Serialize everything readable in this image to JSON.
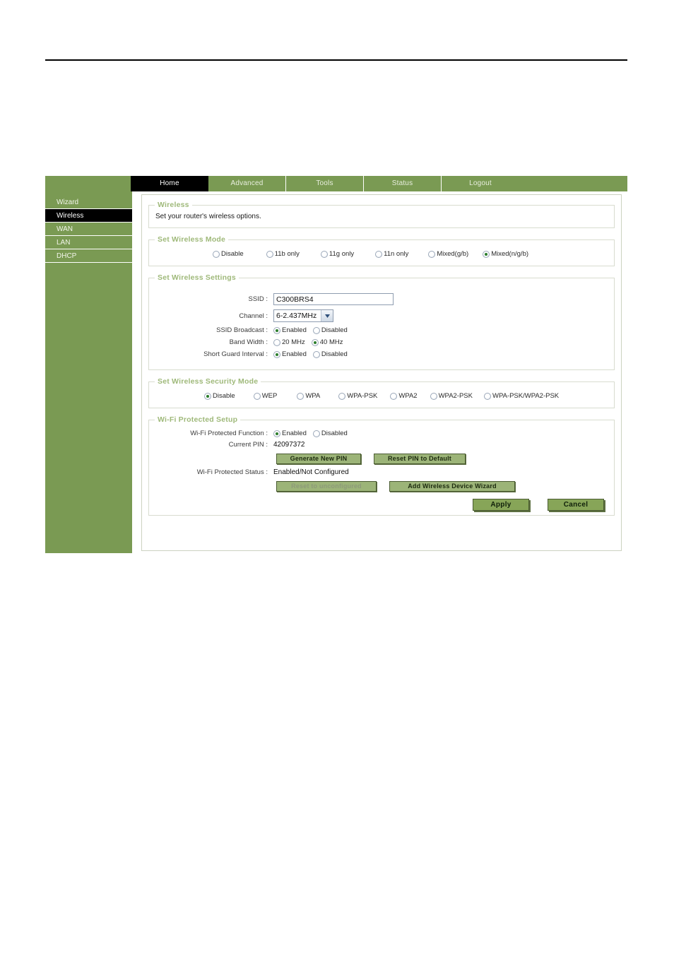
{
  "nav_tabs": [
    {
      "label": "Home",
      "active": true
    },
    {
      "label": "Advanced",
      "active": false
    },
    {
      "label": "Tools",
      "active": false
    },
    {
      "label": "Status",
      "active": false
    },
    {
      "label": "Logout",
      "active": false
    }
  ],
  "sidebar": {
    "items": [
      {
        "label": "Wizard",
        "active": false
      },
      {
        "label": "Wireless",
        "active": true
      },
      {
        "label": "WAN",
        "active": false
      },
      {
        "label": "LAN",
        "active": false
      },
      {
        "label": "DHCP",
        "active": false
      }
    ]
  },
  "wireless_intro": {
    "legend": "Wireless",
    "description": "Set your router's wireless options."
  },
  "wireless_mode": {
    "legend": "Set Wireless Mode",
    "options": [
      {
        "label": "Disable",
        "selected": false
      },
      {
        "label": "11b only",
        "selected": false
      },
      {
        "label": "11g only",
        "selected": false
      },
      {
        "label": "11n only",
        "selected": false
      },
      {
        "label": "Mixed(g/b)",
        "selected": false
      },
      {
        "label": "Mixed(n/g/b)",
        "selected": true
      }
    ]
  },
  "wireless_settings": {
    "legend": "Set Wireless Settings",
    "ssid": {
      "label": "SSID :",
      "value": "C300BRS4"
    },
    "channel": {
      "label": "Channel :",
      "value": "6-2.437MHz"
    },
    "ssid_broadcast": {
      "label": "SSID Broadcast :",
      "options": [
        {
          "label": "Enabled",
          "selected": true
        },
        {
          "label": "Disabled",
          "selected": false
        }
      ]
    },
    "band_width": {
      "label": "Band Width :",
      "options": [
        {
          "label": "20 MHz",
          "selected": false
        },
        {
          "label": "40 MHz",
          "selected": true
        }
      ]
    },
    "short_guard_interval": {
      "label": "Short Guard Interval :",
      "options": [
        {
          "label": "Enabled",
          "selected": true
        },
        {
          "label": "Disabled",
          "selected": false
        }
      ]
    }
  },
  "security_mode": {
    "legend": "Set Wireless Security Mode",
    "options": [
      {
        "label": "Disable",
        "selected": true
      },
      {
        "label": "WEP",
        "selected": false
      },
      {
        "label": "WPA",
        "selected": false
      },
      {
        "label": "WPA-PSK",
        "selected": false
      },
      {
        "label": "WPA2",
        "selected": false
      },
      {
        "label": "WPA2-PSK",
        "selected": false
      },
      {
        "label": "WPA-PSK/WPA2-PSK",
        "selected": false
      }
    ]
  },
  "wps": {
    "legend": "Wi-Fi Protected Setup",
    "function": {
      "label": "Wi-Fi Protected Function :",
      "options": [
        {
          "label": "Enabled",
          "selected": true
        },
        {
          "label": "Disabled",
          "selected": false
        }
      ]
    },
    "current_pin": {
      "label": "Current PIN :",
      "value": "42097372"
    },
    "generate_pin_button": "Generate New PIN",
    "reset_pin_button": "Reset PIN to Default",
    "status": {
      "label": "Wi-Fi Protected Status :",
      "value": "Enabled/Not Configured"
    },
    "reset_unconfigured_button": "Reset to unconfigured",
    "add_wireless_wizard_button": "Add Wireless Device Wizard"
  },
  "actions": {
    "apply": "Apply",
    "cancel": "Cancel"
  },
  "colors": {
    "brand_green": "#7a9a53",
    "legend_green": "#9fb97a",
    "button_green": "#9cb478",
    "active_tab": "#000000"
  }
}
